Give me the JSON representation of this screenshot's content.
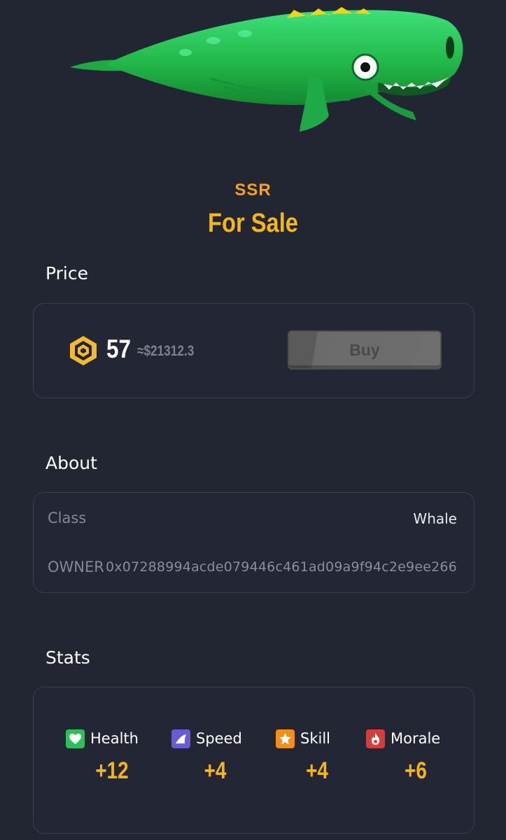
{
  "item": {
    "rarity": "SSR",
    "status": "For Sale"
  },
  "price": {
    "section_title": "Price",
    "currency_icon": "bnb-icon",
    "amount": "57",
    "usd_estimate": "≈$21312.3",
    "buy_label": "Buy"
  },
  "about": {
    "section_title": "About",
    "class_label": "Class",
    "class_value": "Whale",
    "owner_label": "OWNER",
    "owner_value": "0x07288994acde079446c461ad09a9f94c2e9ee266"
  },
  "stats": {
    "section_title": "Stats",
    "items": [
      {
        "label": "Health",
        "value": "+12",
        "icon": "heart-icon",
        "color": "#2fbf5a"
      },
      {
        "label": "Speed",
        "value": "+4",
        "icon": "fin-icon",
        "color": "#6b5ad6"
      },
      {
        "label": "Skill",
        "value": "+4",
        "icon": "star-icon",
        "color": "#f0901a"
      },
      {
        "label": "Morale",
        "value": "+6",
        "icon": "flame-icon",
        "color": "#d93a3a"
      }
    ]
  },
  "colors": {
    "background": "#222532",
    "accent": "#f8b611",
    "rarity": "#f7a21b"
  }
}
